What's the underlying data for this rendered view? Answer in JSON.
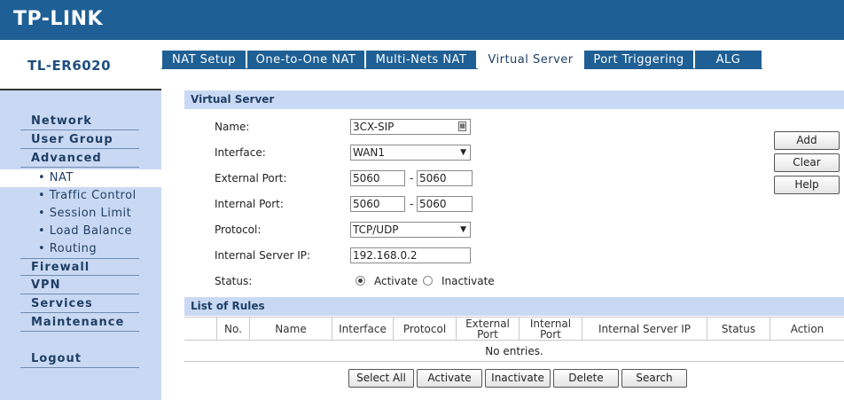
{
  "header": {
    "brand": "TP-LINK"
  },
  "sidebar": {
    "model": "TL-ER6020",
    "items": [
      {
        "label": "Network"
      },
      {
        "label": "User Group"
      },
      {
        "label": "Advanced"
      },
      {
        "label": "• NAT"
      },
      {
        "label": "• Traffic Control"
      },
      {
        "label": "• Session Limit"
      },
      {
        "label": "• Load Balance"
      },
      {
        "label": "• Routing"
      },
      {
        "label": "Firewall"
      },
      {
        "label": "VPN"
      },
      {
        "label": "Services"
      },
      {
        "label": "Maintenance"
      },
      {
        "label": "Logout"
      }
    ]
  },
  "tabs": [
    {
      "label": "NAT Setup"
    },
    {
      "label": "One-to-One NAT"
    },
    {
      "label": "Multi-Nets NAT"
    },
    {
      "label": "Virtual Server"
    },
    {
      "label": "Port Triggering"
    },
    {
      "label": "ALG"
    }
  ],
  "form": {
    "section_title": "Virtual Server",
    "name_label": "Name:",
    "name_value": "3CX-SIP",
    "interface_label": "Interface:",
    "interface_value": "WAN1",
    "ext_port_label": "External Port:",
    "ext_port_from": "5060",
    "ext_port_to": "5060",
    "int_port_label": "Internal Port:",
    "int_port_from": "5060",
    "int_port_to": "5060",
    "protocol_label": "Protocol:",
    "protocol_value": "TCP/UDP",
    "server_ip_label": "Internal Server IP:",
    "server_ip_value": "192.168.0.2",
    "status_label": "Status:",
    "status_activate": "Activate",
    "status_inactivate": "Inactivate",
    "status_selected": "Activate",
    "dash": "-"
  },
  "side_buttons": {
    "add": "Add",
    "clear": "Clear",
    "help": "Help"
  },
  "rules": {
    "section_title": "List of Rules",
    "columns": [
      "",
      "No.",
      "Name",
      "Interface",
      "Protocol",
      "External Port",
      "Internal Port",
      "Internal Server IP",
      "Status",
      "Action"
    ],
    "empty_text": "No entries."
  },
  "bottom_buttons": {
    "select_all": "Select All",
    "activate": "Activate",
    "inactivate": "Inactivate",
    "delete": "Delete",
    "search": "Search"
  },
  "colors": {
    "brand_blue": "#1e5f95",
    "light_blue": "#cad9f3",
    "text_blue": "#1f3f66"
  }
}
